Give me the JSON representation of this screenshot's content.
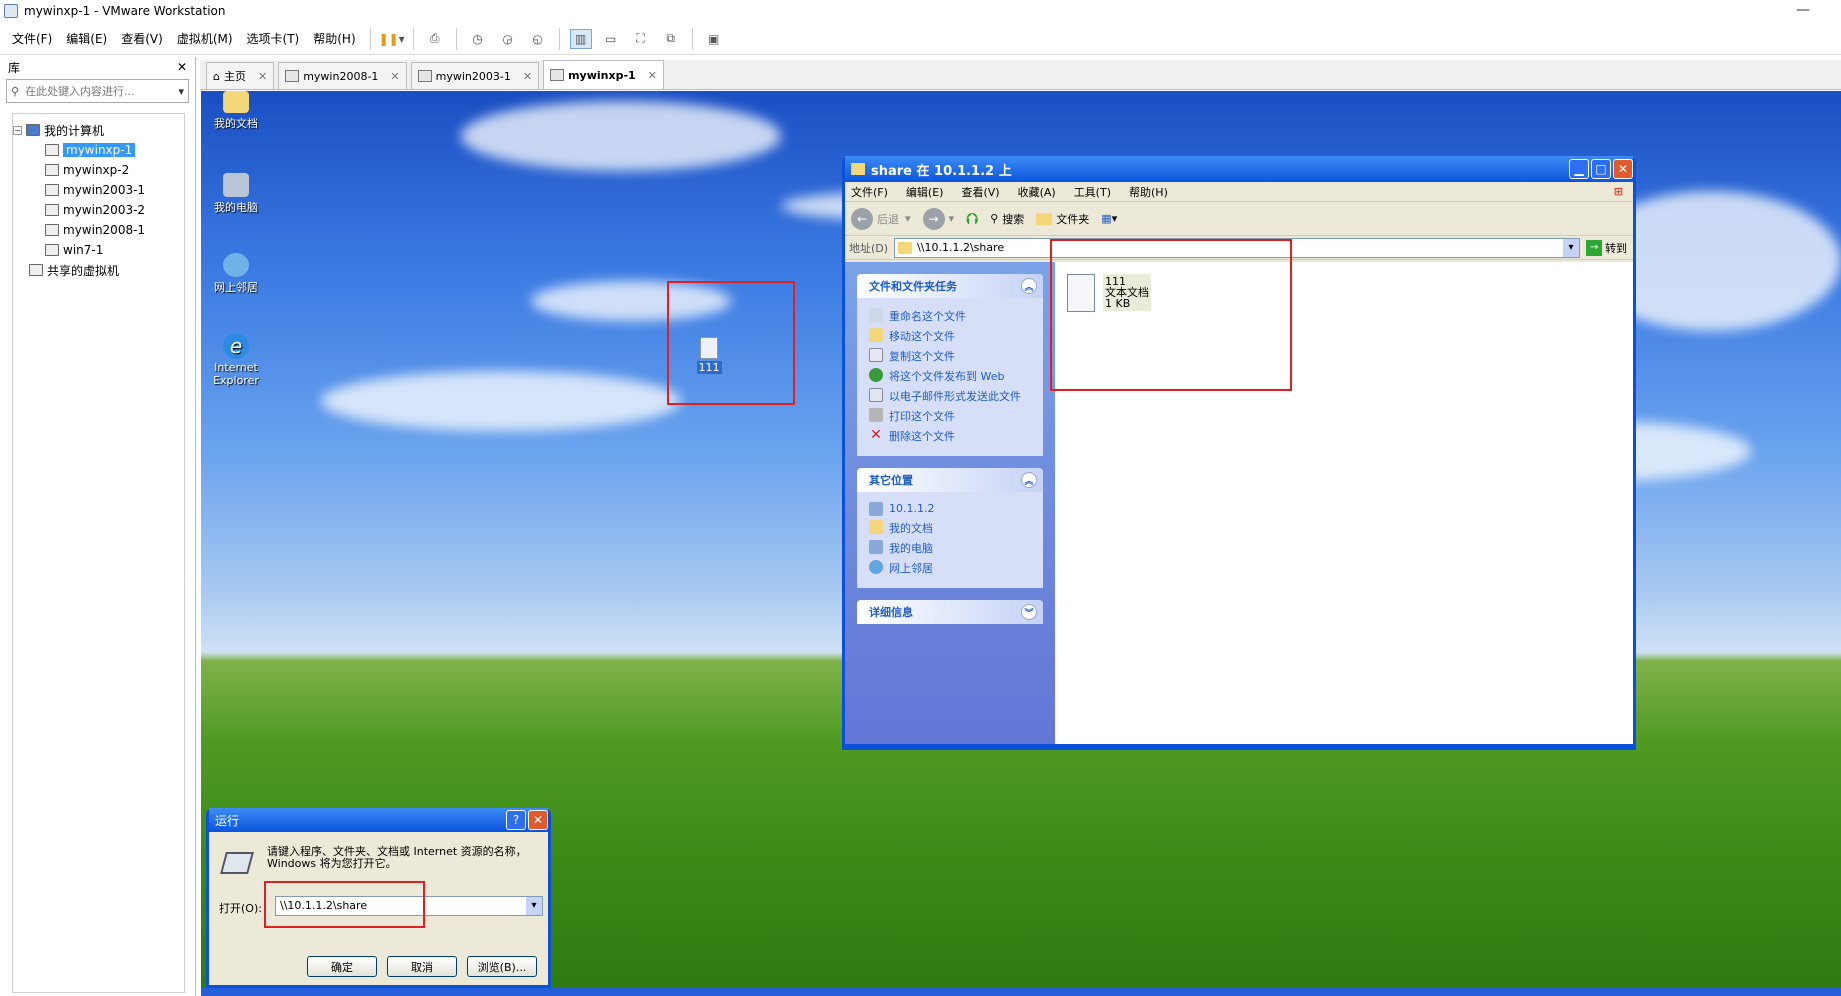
{
  "window": {
    "title": "mywinxp-1 - VMware Workstation",
    "minimize": "—",
    "close": "✕"
  },
  "menu": [
    "文件(F)",
    "编辑(E)",
    "查看(V)",
    "虚拟机(M)",
    "选项卡(T)",
    "帮助(H)"
  ],
  "sidebar": {
    "header": "库",
    "close": "✕",
    "search_placeholder": "在此处键入内容进行...",
    "tree_root": "我的计算机",
    "vms": [
      "mywinxp-1",
      "mywinxp-2",
      "mywin2003-1",
      "mywin2003-2",
      "mywin2008-1",
      "win7-1"
    ],
    "selected": "mywinxp-1",
    "shared": "共享的虚拟机"
  },
  "tabs": [
    {
      "label": "主页"
    },
    {
      "label": "mywin2008-1"
    },
    {
      "label": "mywin2003-1"
    },
    {
      "label": "mywinxp-1",
      "active": true
    }
  ],
  "desktop": {
    "icons": [
      "我的文档",
      "我的电脑",
      "网上邻居",
      "Internet Explorer"
    ],
    "file_icon": "111"
  },
  "explorer": {
    "title": "share 在 10.1.1.2 上",
    "menu": [
      "文件(F)",
      "编辑(E)",
      "查看(V)",
      "收藏(A)",
      "工具(T)",
      "帮助(H)"
    ],
    "toolbar": {
      "back": "后退",
      "search": "搜索",
      "folders": "文件夹"
    },
    "address_label": "地址(D)",
    "address": "\\\\10.1.1.2\\share",
    "go": "转到",
    "tasks_header": "文件和文件夹任务",
    "tasks": [
      "重命名这个文件",
      "移动这个文件",
      "复制这个文件",
      "将这个文件发布到 Web",
      "以电子邮件形式发送此文件",
      "打印这个文件",
      "删除这个文件"
    ],
    "places_header": "其它位置",
    "places": [
      "10.1.1.2",
      "我的文档",
      "我的电脑",
      "网上邻居"
    ],
    "details_header": "详细信息",
    "file": {
      "name": "111",
      "type": "文本文档",
      "size": "1 KB"
    }
  },
  "run": {
    "title": "运行",
    "help": "?",
    "close": "✕",
    "prompt": "请键入程序、文件夹、文档或 Internet 资源的名称，Windows 将为您打开它。",
    "open_label": "打开(O):",
    "value": "\\\\10.1.1.2\\share",
    "ok": "确定",
    "cancel": "取消",
    "browse": "浏览(B)..."
  }
}
